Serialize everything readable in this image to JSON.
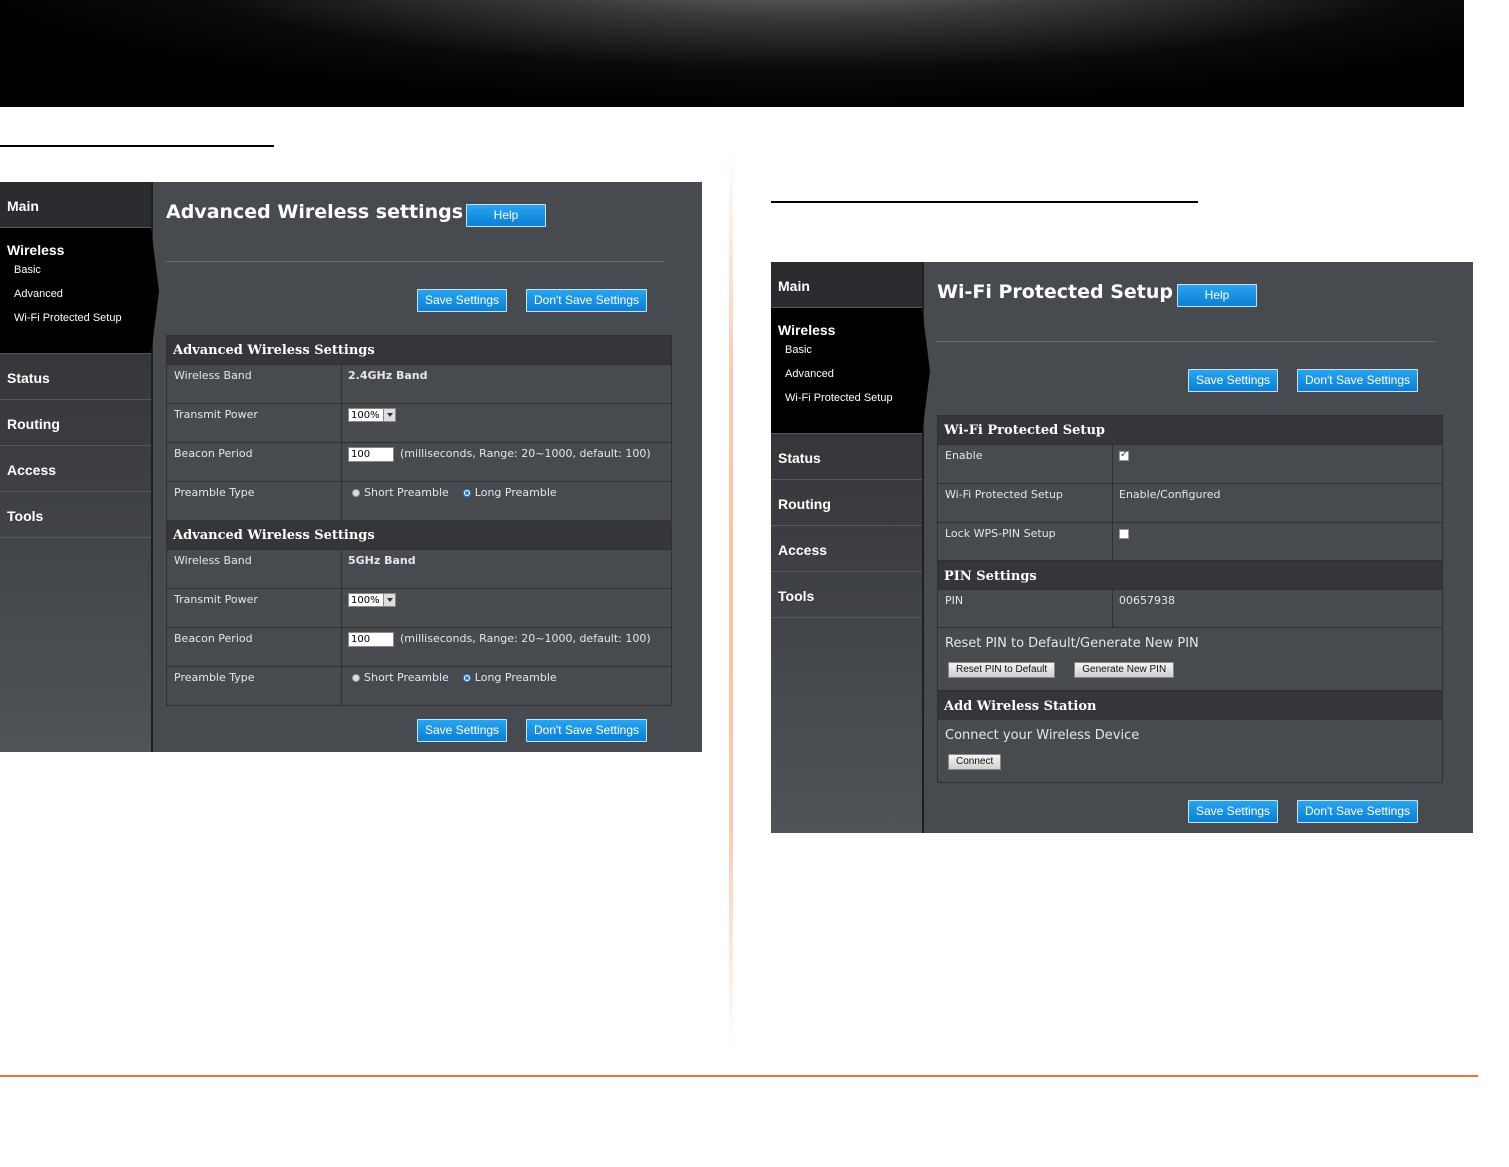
{
  "left": {
    "nav": {
      "main": "Main",
      "wireless": "Wireless",
      "sub": [
        "Basic",
        "Advanced",
        "Wi-Fi Protected Setup"
      ],
      "status": "Status",
      "routing": "Routing",
      "access": "Access",
      "tools": "Tools"
    },
    "title": "Advanced Wireless settings",
    "help": "Help",
    "save": "Save Settings",
    "dont_save": "Don't Save Settings",
    "section1": {
      "header": "Advanced Wireless Settings",
      "band_label": "Wireless Band",
      "band_value": "2.4GHz Band",
      "tx_label": "Transmit Power",
      "tx_value": "100%",
      "beacon_label": "Beacon Period",
      "beacon_value": "100",
      "beacon_hint": "(milliseconds, Range: 20~1000, default: 100)",
      "preamble_label": "Preamble Type",
      "short": "Short Preamble",
      "long": "Long Preamble"
    },
    "section2": {
      "header": "Advanced Wireless Settings",
      "band_label": "Wireless Band",
      "band_value": "5GHz Band",
      "tx_label": "Transmit Power",
      "tx_value": "100%",
      "beacon_label": "Beacon Period",
      "beacon_value": "100",
      "beacon_hint": "(milliseconds, Range: 20~1000, default: 100)",
      "preamble_label": "Preamble Type",
      "short": "Short Preamble",
      "long": "Long Preamble"
    }
  },
  "right": {
    "nav": {
      "main": "Main",
      "wireless": "Wireless",
      "sub": [
        "Basic",
        "Advanced",
        "Wi-Fi Protected Setup"
      ],
      "status": "Status",
      "routing": "Routing",
      "access": "Access",
      "tools": "Tools"
    },
    "title": "Wi-Fi Protected Setup",
    "help": "Help",
    "save": "Save Settings",
    "dont_save": "Don't Save Settings",
    "wps": {
      "header": "Wi-Fi Protected Setup",
      "enable_label": "Enable",
      "wps_label": "Wi-Fi Protected Setup",
      "wps_value": "Enable/Configured",
      "lock_label": "Lock WPS-PIN Setup"
    },
    "pin": {
      "header": "PIN Settings",
      "pin_label": "PIN",
      "pin_value": "00657938",
      "reset_text": "Reset PIN to Default/Generate New PIN",
      "reset_btn": "Reset PIN to Default",
      "generate_btn": "Generate New PIN"
    },
    "station": {
      "header": "Add Wireless Station",
      "connect_text": "Connect your Wireless Device",
      "connect_btn": "Connect"
    }
  }
}
